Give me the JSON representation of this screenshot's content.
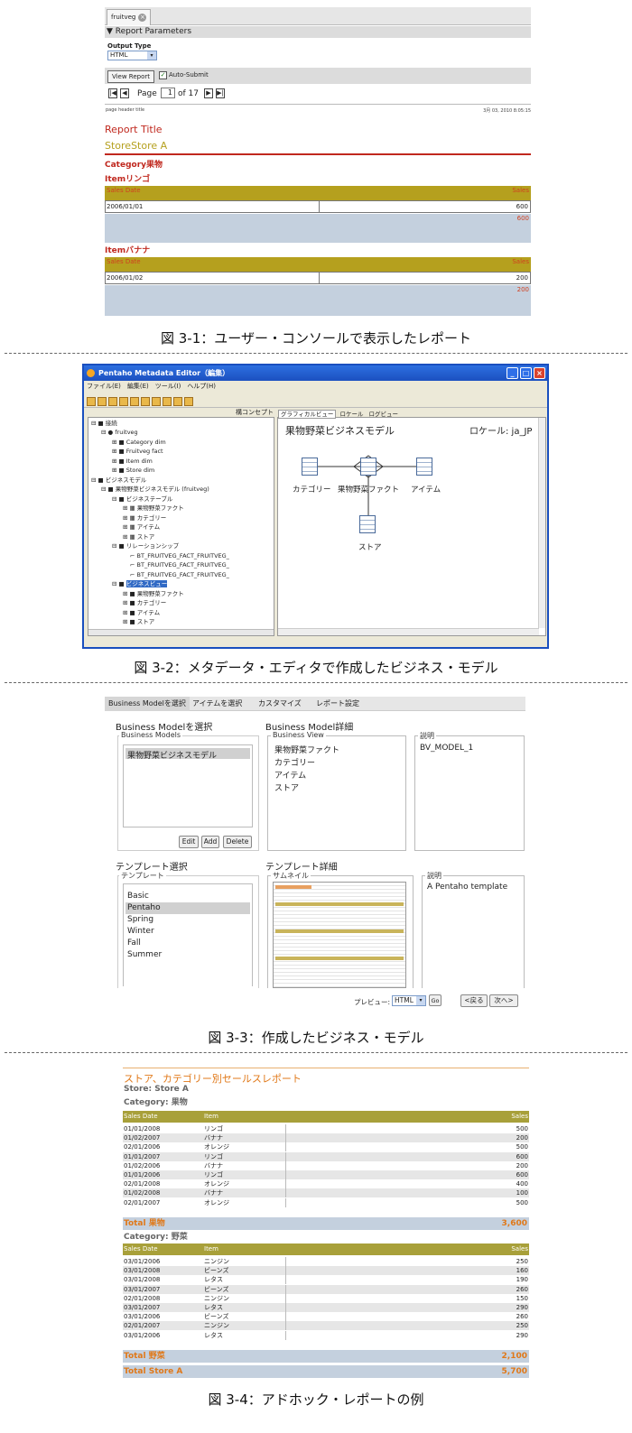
{
  "fig1": {
    "tab": "fruitveg",
    "params_header": "Report Parameters",
    "output_type_label": "Output Type",
    "output_type_value": "HTML",
    "view_report": "View Report",
    "auto_submit": "Auto-Submit",
    "page_label": "Page",
    "page_value": "1",
    "page_of": "of 17",
    "page_header_title": "page header title",
    "date": "3月 03, 2010 8:05:15",
    "report_title": "Report Title",
    "store": "StoreStore A",
    "category": "Category果物",
    "items": [
      {
        "label": "Itemリンゴ",
        "h_left": "Sales Date",
        "h_right": "Sales",
        "date": "2006/01/01",
        "value": "600",
        "total": "600"
      },
      {
        "label": "Itemバナナ",
        "h_left": "Sales Date",
        "h_right": "Sales",
        "date": "2006/01/02",
        "value": "200",
        "total": "200"
      }
    ],
    "caption": "図 3-1：ユーザー・コンソールで表示したレポート"
  },
  "fig2": {
    "title": "Pentaho Metadata Editor（編集）",
    "menu": [
      "ファイル(E)",
      "編集(E)",
      "ツール(I)",
      "ヘルプ(H)"
    ],
    "tree_tab": "構コンセプト",
    "tree": [
      "接続",
      "fruitveg",
      "Category dim",
      "Fruitveg fact",
      "Item dim",
      "Store dim",
      "ビジネスモデル",
      "果物野菜ビジネスモデル (fruitveg)",
      "ビジネステーブル",
      "果物野菜ファクト",
      "カテゴリー",
      "アイテム",
      "ストア",
      "リレーションシップ",
      "BT_FRUITVEG_FACT_FRUITVEG_",
      "BT_FRUITVEG_FACT_FRUITVEG_",
      "BT_FRUITVEG_FACT_FRUITVEG_",
      "ビジネスビュー",
      "果物野菜ファクト",
      "カテゴリー",
      "アイテム",
      "ストア"
    ],
    "view_tabs": [
      "グラフィカルビュー",
      "ロケール",
      "ログビュー"
    ],
    "model_name": "果物野菜ビジネスモデル",
    "locale": "ロケール: ja_JP",
    "nodes": [
      "カテゴリー",
      "果物野菜ファクト",
      "アイテム",
      "ストア"
    ],
    "caption": "図 3-2：メタデータ・エディタで作成したビジネス・モデル"
  },
  "fig3": {
    "steps": [
      "Business Modelを選択",
      "アイテムを選択",
      "カスタマイズ",
      "レポート設定"
    ],
    "bm_title": "Business Modelを選択",
    "bm_legend": "Business Models",
    "bm_items": [
      "果物野菜ビジネスモデル"
    ],
    "btn_edit": "Edit",
    "btn_add": "Add",
    "btn_delete": "Delete",
    "detail_title": "Business Model詳細",
    "bv_legend": "Business View",
    "bv_items": [
      "果物野菜ファクト",
      "カテゴリー",
      "アイテム",
      "ストア"
    ],
    "desc_legend": "説明",
    "desc_value": "BV_MODEL_1",
    "tpl_title": "テンプレート選択",
    "tpl_legend": "テンプレート",
    "tpl_items": [
      "Basic",
      "Pentaho",
      "Spring",
      "Winter",
      "Fall",
      "Summer"
    ],
    "tpl_detail_title": "テンプレート詳細",
    "thumb_legend": "サムネイル",
    "desc2_legend": "説明",
    "desc2_value": "A Pentaho template",
    "preview_label": "プレビュー:",
    "preview_value": "HTML",
    "go": "Go",
    "back": "<戻る",
    "next": "次へ>",
    "caption": "図 3-3：作成したビジネス・モデル"
  },
  "fig4": {
    "title": "ストア、カテゴリー別セールスレポート",
    "store": "Store: Store A",
    "groups": [
      {
        "category": "Category: 果物",
        "header": [
          "Sales Date",
          "Item",
          "Sales"
        ],
        "rows": [
          [
            "01/01/2008",
            "リンゴ",
            "500"
          ],
          [
            "01/02/2007",
            "バナナ",
            "200"
          ],
          [
            "02/01/2006",
            "オレンジ",
            "500"
          ],
          [
            "01/01/2007",
            "リンゴ",
            "600"
          ],
          [
            "01/02/2006",
            "バナナ",
            "200"
          ],
          [
            "01/01/2006",
            "リンゴ",
            "600"
          ],
          [
            "02/01/2008",
            "オレンジ",
            "400"
          ],
          [
            "01/02/2008",
            "バナナ",
            "100"
          ],
          [
            "02/01/2007",
            "オレンジ",
            "500"
          ]
        ],
        "total_label": "Total 果物",
        "total_value": "3,600"
      },
      {
        "category": "Category: 野菜",
        "header": [
          "Sales Date",
          "Item",
          "Sales"
        ],
        "rows": [
          [
            "03/01/2006",
            "ニンジン",
            "250"
          ],
          [
            "03/01/2008",
            "ビーンズ",
            "160"
          ],
          [
            "03/01/2008",
            "レタス",
            "190"
          ],
          [
            "03/01/2007",
            "ビーンズ",
            "260"
          ],
          [
            "02/01/2008",
            "ニンジン",
            "150"
          ],
          [
            "03/01/2007",
            "レタス",
            "290"
          ],
          [
            "03/01/2006",
            "ビーンズ",
            "260"
          ],
          [
            "02/01/2007",
            "ニンジン",
            "250"
          ],
          [
            "03/01/2006",
            "レタス",
            "290"
          ]
        ],
        "total_label": "Total 野菜",
        "total_value": "2,100"
      }
    ],
    "grand_label": "Total Store A",
    "grand_value": "5,700",
    "caption": "図 3-4：アドホック・レポートの例"
  }
}
